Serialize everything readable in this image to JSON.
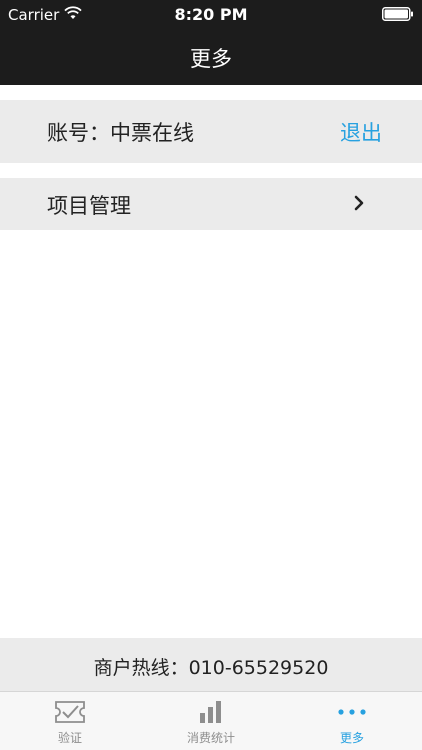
{
  "status_bar": {
    "carrier": "Carrier",
    "time": "8:20 PM"
  },
  "nav": {
    "title": "更多"
  },
  "account": {
    "label": "账号：中票在线",
    "logout_label": "退出"
  },
  "menu": {
    "project_management_label": "项目管理"
  },
  "hotline": {
    "text": "商户热线：010-65529520"
  },
  "tabs": [
    {
      "label": "验证",
      "icon": "ticket-check-icon",
      "active": false
    },
    {
      "label": "消费统计",
      "icon": "bar-chart-icon",
      "active": false
    },
    {
      "label": "更多",
      "icon": "more-dots-icon",
      "active": true
    }
  ],
  "colors": {
    "accent": "#27a1e0",
    "topbar": "#1c1c1c",
    "row_background": "#ebebeb"
  }
}
